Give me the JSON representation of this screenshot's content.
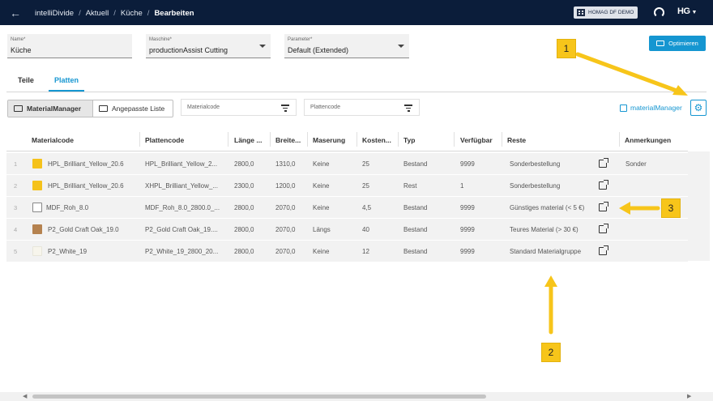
{
  "topbar": {
    "breadcrumb": [
      "intelliDivide",
      "Aktuell",
      "Küche",
      "Bearbeiten"
    ],
    "tenant": "HOMAG DF DEMO",
    "logo": "HG"
  },
  "form": {
    "name": {
      "label": "Name*",
      "value": "Küche"
    },
    "machine": {
      "label": "Maschine*",
      "value": "productionAssist Cutting"
    },
    "parameter": {
      "label": "Parameter*",
      "value": "Default (Extended)"
    },
    "optimize_label": "Optimieren"
  },
  "tabs": [
    "Teile",
    "Platten"
  ],
  "filters": {
    "segment": [
      "MaterialManager",
      "Angepasste Liste"
    ],
    "materialcode_placeholder": "Materialcode",
    "plattencode_placeholder": "Plattencode",
    "material_manager_link": "materialManager"
  },
  "table": {
    "columns": [
      "Materialcode",
      "Plattencode",
      "Länge ...",
      "Breite...",
      "Maserung",
      "Kosten...",
      "Typ",
      "Verfügbar",
      "Reste",
      "Anmerkungen"
    ],
    "rows": [
      {
        "num": "1",
        "material": "HPL_Brilliant_Yellow_20.6",
        "swatch": "#f5c21b",
        "platte": "HPL_Brilliant_Yellow_2...",
        "laenge": "2800,0",
        "breite": "1310,0",
        "maserung": "Keine",
        "kosten": "25",
        "typ": "Bestand",
        "verfuegbar": "9999",
        "reste": "Sonderbestellung",
        "anmerkungen": "Sonder"
      },
      {
        "num": "2",
        "material": "HPL_Brilliant_Yellow_20.6",
        "swatch": "#f5c21b",
        "platte": "XHPL_Brilliant_Yellow_...",
        "laenge": "2300,0",
        "breite": "1200,0",
        "maserung": "Keine",
        "kosten": "25",
        "typ": "Rest",
        "verfuegbar": "1",
        "reste": "Sonderbestellung",
        "anmerkungen": ""
      },
      {
        "num": "3",
        "material": "MDF_Roh_8.0",
        "swatch": "image",
        "platte": "MDF_Roh_8.0_2800.0_...",
        "laenge": "2800,0",
        "breite": "2070,0",
        "maserung": "Keine",
        "kosten": "4,5",
        "typ": "Bestand",
        "verfuegbar": "9999",
        "reste": "Günstiges material (< 5 €)",
        "anmerkungen": ""
      },
      {
        "num": "4",
        "material": "P2_Gold Craft Oak_19.0",
        "swatch": "#b5824f",
        "platte": "P2_Gold Craft Oak_19....",
        "laenge": "2800,0",
        "breite": "2070,0",
        "maserung": "Längs",
        "kosten": "40",
        "typ": "Bestand",
        "verfuegbar": "9999",
        "reste": "Teures Material (> 30 €)",
        "anmerkungen": ""
      },
      {
        "num": "5",
        "material": "P2_White_19",
        "swatch": "#f7f5ec",
        "platte": "P2_White_19_2800_20...",
        "laenge": "2800,0",
        "breite": "2070,0",
        "maserung": "Keine",
        "kosten": "12",
        "typ": "Bestand",
        "verfuegbar": "9999",
        "reste": "Standard Materialgruppe",
        "anmerkungen": ""
      }
    ]
  },
  "callouts": [
    "1",
    "2",
    "3"
  ],
  "colors": {
    "accent": "#1596d1",
    "topbar": "#0b1d3a",
    "callout": "#f7c51a"
  },
  "icons": [
    "back-arrow-icon",
    "building-icon",
    "headset-icon",
    "monitor-icon",
    "edit-list-icon",
    "filter-icon",
    "external-link-icon",
    "gear-icon"
  ]
}
